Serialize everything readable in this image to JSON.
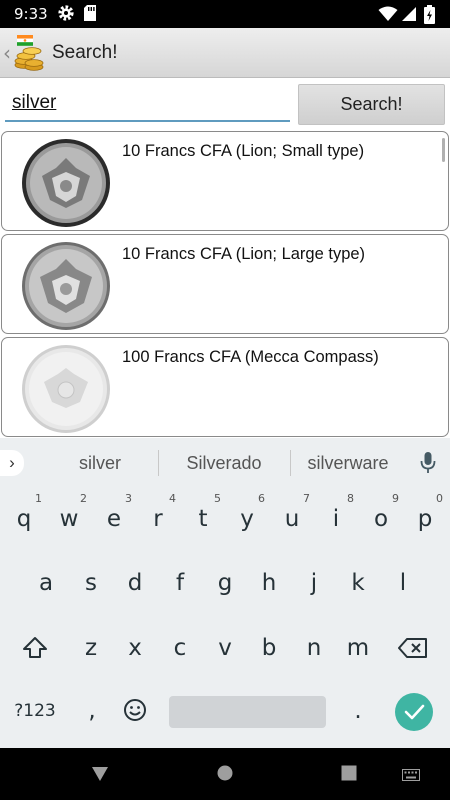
{
  "status_bar": {
    "time": "9:33",
    "icons": [
      "gear-icon",
      "sd-card-icon",
      "wifi-icon",
      "signal-icon",
      "battery-icon"
    ]
  },
  "app_bar": {
    "title": "Search!",
    "icons": [
      "back-chevron-icon",
      "app-logo-icon"
    ]
  },
  "search": {
    "value": "silver",
    "button_label": "Search!"
  },
  "results": [
    {
      "name": "10 Francs CFA (Lion; Small type)",
      "image": "coin-image"
    },
    {
      "name": "10 Francs CFA (Lion; Large type)",
      "image": "coin-image"
    },
    {
      "name": "100 Francs CFA (Mecca Compass)",
      "image": "coin-image"
    }
  ],
  "keyboard": {
    "suggestions": [
      "silver",
      "Silverado",
      "silverware"
    ],
    "row1": [
      {
        "key": "q",
        "hint": "1"
      },
      {
        "key": "w",
        "hint": "2"
      },
      {
        "key": "e",
        "hint": "3"
      },
      {
        "key": "r",
        "hint": "4"
      },
      {
        "key": "t",
        "hint": "5"
      },
      {
        "key": "y",
        "hint": "6"
      },
      {
        "key": "u",
        "hint": "7"
      },
      {
        "key": "i",
        "hint": "8"
      },
      {
        "key": "o",
        "hint": "9"
      },
      {
        "key": "p",
        "hint": "0"
      }
    ],
    "row2": [
      "a",
      "s",
      "d",
      "f",
      "g",
      "h",
      "j",
      "k",
      "l"
    ],
    "row3": [
      "z",
      "x",
      "c",
      "v",
      "b",
      "n",
      "m"
    ],
    "symbols_label": "?123",
    "comma": ",",
    "period": ".",
    "icons": [
      "shift-icon",
      "backspace-icon",
      "emoji-icon",
      "enter-check-icon",
      "mic-icon",
      "expand-arrow-icon"
    ]
  },
  "nav_bar": {
    "icons": [
      "back-triangle-icon",
      "home-circle-icon",
      "recents-square-icon",
      "keyboard-switch-icon"
    ]
  },
  "colors": {
    "accent": "#3fb5a3",
    "input_underline": "#5f9bbf",
    "keyboard_bg": "#eceff1"
  }
}
